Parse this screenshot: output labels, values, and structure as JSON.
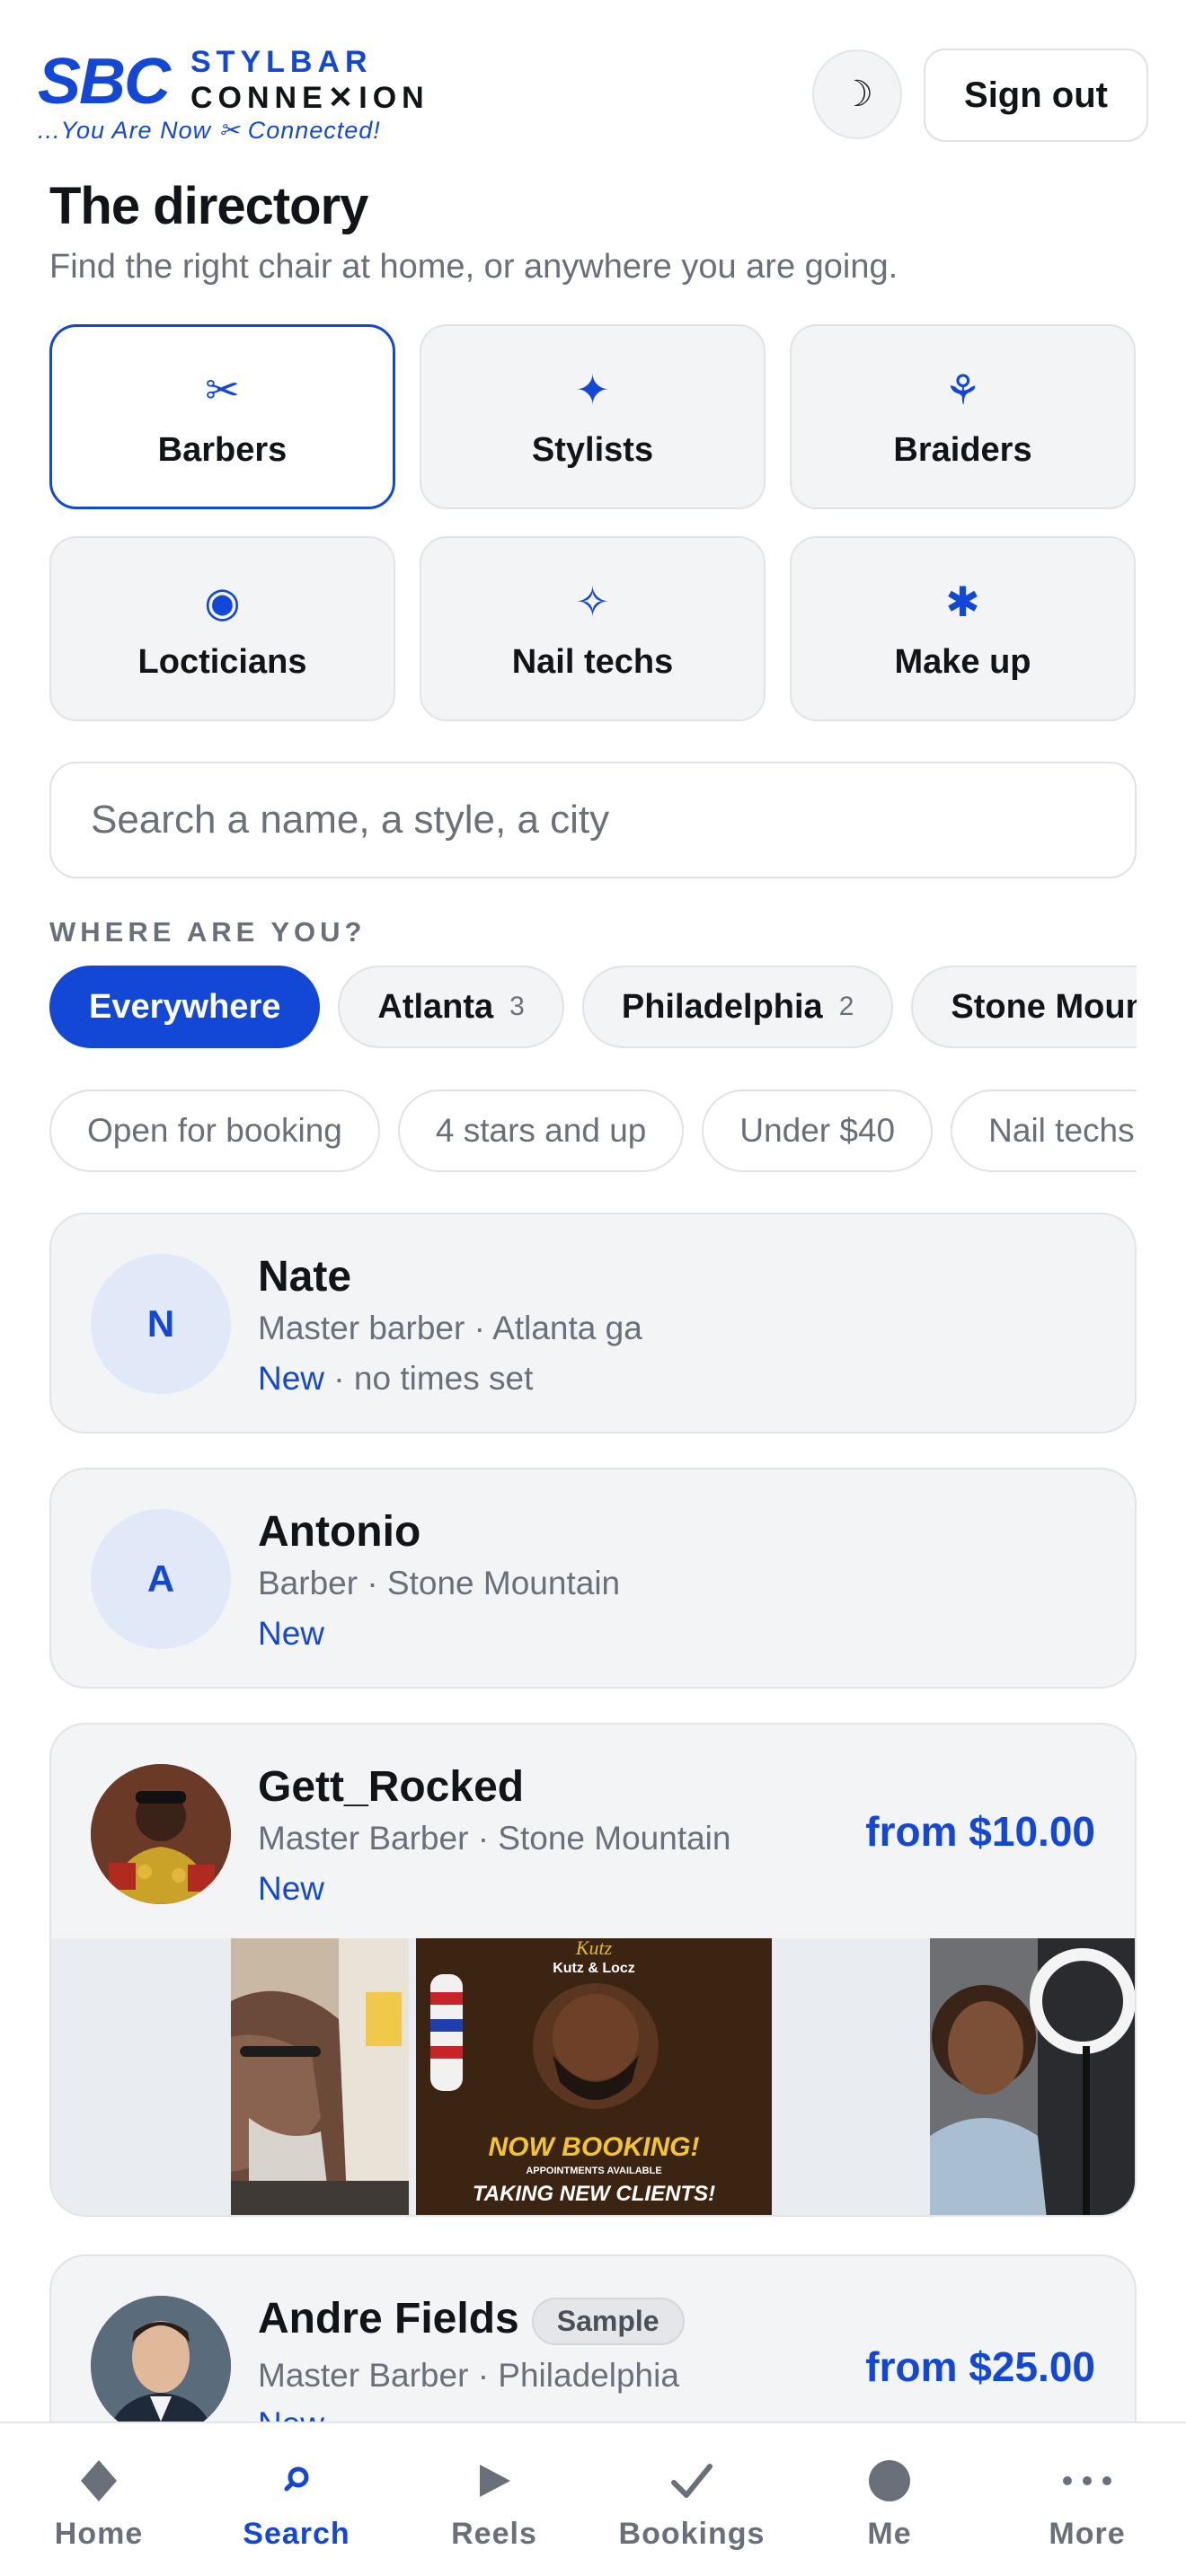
{
  "header": {
    "logo": {
      "short": "SBC",
      "line1": "STYLBAR",
      "line2": "CONNE✕ION",
      "tagline": "...You Are Now ✂ Connected!"
    },
    "theme_toggle_glyph": "☽",
    "signout_label": "Sign out"
  },
  "page": {
    "title": "The directory",
    "subtitle": "Find the right chair at home, or anywhere you are going."
  },
  "categories": [
    {
      "label": "Barbers",
      "icon": "scissors-icon",
      "glyph": "✂",
      "active": true
    },
    {
      "label": "Stylists",
      "icon": "sparkle-icon",
      "glyph": "✦",
      "active": false
    },
    {
      "label": "Braiders",
      "icon": "flower-icon",
      "glyph": "⚘",
      "active": false
    },
    {
      "label": "Locticians",
      "icon": "target-icon",
      "glyph": "◉",
      "active": false
    },
    {
      "label": "Nail techs",
      "icon": "star-outline-icon",
      "glyph": "✧",
      "active": false
    },
    {
      "label": "Make up",
      "icon": "asterisk-icon",
      "glyph": "✱",
      "active": false
    }
  ],
  "search": {
    "placeholder": "Search a name, a style, a city"
  },
  "location": {
    "label": "WHERE ARE YOU?",
    "chips": [
      {
        "label": "Everywhere",
        "count": "",
        "active": true
      },
      {
        "label": "Atlanta",
        "count": "3",
        "active": false
      },
      {
        "label": "Philadelphia",
        "count": "2",
        "active": false
      },
      {
        "label": "Stone Mountain",
        "count": "",
        "active": false
      }
    ]
  },
  "filters": [
    "Open for booking",
    "4 stars and up",
    "Under $40",
    "Nail techs"
  ],
  "listings": [
    {
      "initial": "N",
      "name": "Nate",
      "meta": "Master barber · Atlanta ga",
      "status_new": "New",
      "status_rest": " · no times set",
      "price": ""
    },
    {
      "initial": "A",
      "name": "Antonio",
      "meta": "Barber · Stone Mountain",
      "status_new": "New",
      "status_rest": "",
      "price": ""
    },
    {
      "initial": "",
      "name": "Gett_Rocked",
      "meta": "Master Barber · Stone Mountain",
      "status_new": "New",
      "status_rest": "",
      "price": "from $10.00"
    },
    {
      "initial": "",
      "name": "Andre Fields",
      "badge": "Sample",
      "meta": "Master Barber · Philadelphia",
      "status_new": "New",
      "status_rest": "",
      "price": "from $25.00"
    }
  ],
  "gallery_poster": {
    "brand": "Kutz & Locz",
    "line1": "NOW BOOKING!",
    "line2": "APPOINTMENTS AVAILABLE",
    "line3": "TAKING NEW CLIENTS!"
  },
  "nav": [
    {
      "label": "Home",
      "icon": "diamond-icon",
      "active": false
    },
    {
      "label": "Search",
      "icon": "search-icon",
      "active": true
    },
    {
      "label": "Reels",
      "icon": "play-icon",
      "active": false
    },
    {
      "label": "Bookings",
      "icon": "check-icon",
      "active": false
    },
    {
      "label": "Me",
      "icon": "profile-icon",
      "active": false
    },
    {
      "label": "More",
      "icon": "more-icon",
      "active": false
    }
  ],
  "colors": {
    "accent": "#1347d6",
    "muted": "#6a707a",
    "card_bg": "#f3f4f6",
    "border": "#e1e3e7"
  }
}
